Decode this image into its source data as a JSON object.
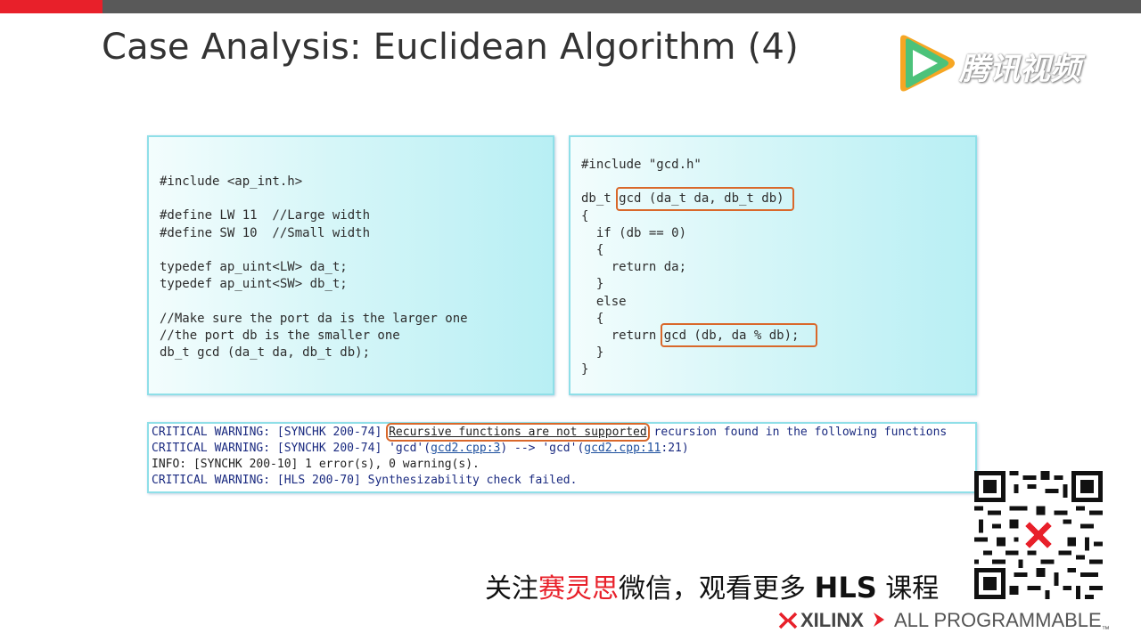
{
  "slide": {
    "title": "Case Analysis: Euclidean Algorithm (4)",
    "accent_color": "#e8202a",
    "bar_color": "#595959"
  },
  "watermark": {
    "icon": "tencent-video-play-icon",
    "text": "腾讯视频"
  },
  "header_panel": {
    "lines": [
      "#include <ap_int.h>",
      "",
      "#define LW 11  //Large width",
      "#define SW 10  //Small width",
      "",
      "typedef ap_uint<LW> da_t;",
      "typedef ap_uint<SW> db_t;",
      "",
      "//Make sure the port da is the larger one",
      "//the port db is the smaller one",
      "db_t gcd (da_t da, db_t db);"
    ]
  },
  "source_panel": {
    "lines": [
      "#include \"gcd.h\"",
      "",
      "db_t gcd (da_t da, db_t db)",
      "{",
      "  if (db == 0)",
      "  {",
      "    return da;",
      "  }",
      "  else",
      "  {",
      "    return gcd (db, da % db);",
      "  }",
      "}"
    ],
    "highlights": [
      "gcd (da_t da, db_t db)",
      "gcd (db, da % db);"
    ],
    "highlight_color": "#d9682b"
  },
  "console": {
    "line1_prefix": "CRITICAL WARNING: [SYNCHK 200-74] ",
    "line1_highlight": "Recursive functions are not supported",
    "line1_suffix": " recursion found in the following functions",
    "line2_prefix": "CRITICAL WARNING: [SYNCHK 200-74] 'gcd'(",
    "line2_link1": "gcd2.cpp:3",
    "line2_mid": ") --> 'gcd'(",
    "line2_link2": "gcd2.cpp:11",
    "line2_suffix": ":21)",
    "line3": "INFO: [SYNCHK 200-10] 1 error(s), 0 warning(s).",
    "line4": "CRITICAL WARNING: [HLS 200-70] Synthesizability check failed."
  },
  "promo": {
    "part1": "关注",
    "part2": "赛灵思",
    "part3": "微信，观看更多 ",
    "part4": "HLS",
    "part5": " 课程",
    "qr_icon": "qr-code-icon"
  },
  "footer": {
    "brand": "XILINX",
    "tagline": "ALL PROGRAMMABLE",
    "tm": "™"
  }
}
